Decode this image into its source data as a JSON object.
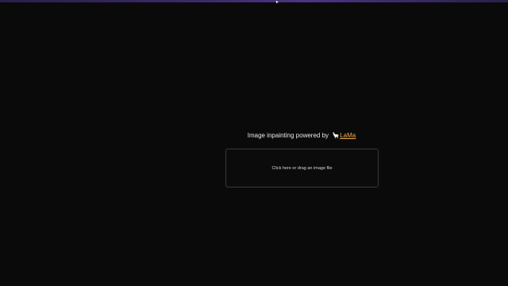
{
  "header": {
    "text_prefix": "Image inpainting powered by",
    "llama_icon": "🦙",
    "link_label": "LaMa"
  },
  "dropzone": {
    "label": "Click here or drag an image file"
  },
  "colors": {
    "background": "#0a0a0a",
    "link": "#f0a94a",
    "topbar": "#3b2a6a"
  }
}
